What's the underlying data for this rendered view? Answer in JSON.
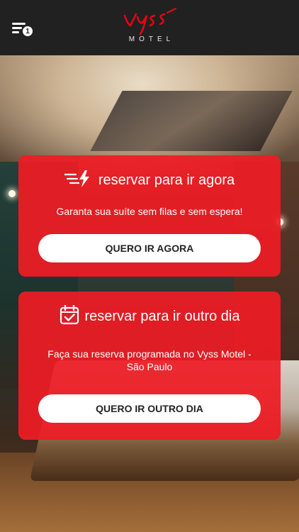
{
  "header": {
    "menu_badge_count": "1",
    "logo_script": "vyss",
    "logo_sub": "MOTEL"
  },
  "cards": {
    "now": {
      "title": "reservar para ir agora",
      "description": "Garanta sua suíte sem filas e sem espera!",
      "button": "QUERO IR AGORA",
      "icon": "fast-lightning-icon"
    },
    "later": {
      "title": "reservar para ir outro dia",
      "description": "Faça sua reserva programada no Vyss Motel - São Paulo",
      "button": "QUERO IR OUTRO DIA",
      "icon": "calendar-check-icon"
    }
  },
  "colors": {
    "header_bg": "#212121",
    "card_red": "#EE1C25",
    "button_bg": "#FFFFFF",
    "logo_red": "#E30613"
  }
}
